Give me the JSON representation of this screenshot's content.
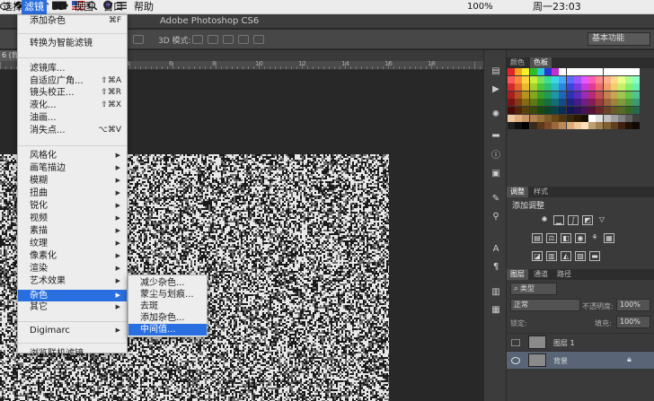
{
  "menubar": {
    "items": [
      "选择",
      "滤镜",
      "3D",
      "视图",
      "窗口",
      "帮助"
    ],
    "active_item": "滤镜",
    "battery": "100%",
    "clock": "周一23:03"
  },
  "app": {
    "title": "Adobe Photoshop CS6",
    "options_label": "3D 模式:",
    "workspace": "基本功能",
    "doc_tab": "6 (背景"
  },
  "ruler": {
    "labels": [
      "4",
      "6",
      "8",
      "10",
      "12",
      "14",
      "16",
      "18"
    ]
  },
  "filter_menu": {
    "items": [
      {
        "label": "添加杂色",
        "shortcut": "⌘F"
      },
      {
        "label": "转换为智能滤镜"
      },
      {
        "label": "滤镜库..."
      },
      {
        "label": "自适应广角...",
        "shortcut": "⇧⌘A"
      },
      {
        "label": "镜头校正...",
        "shortcut": "⇧⌘R"
      },
      {
        "label": "液化...",
        "shortcut": "⇧⌘X"
      },
      {
        "label": "油画..."
      },
      {
        "label": "消失点...",
        "shortcut": "⌥⌘V"
      },
      {
        "label": "风格化",
        "submenu": true
      },
      {
        "label": "画笔描边",
        "submenu": true
      },
      {
        "label": "模糊",
        "submenu": true
      },
      {
        "label": "扭曲",
        "submenu": true
      },
      {
        "label": "锐化",
        "submenu": true
      },
      {
        "label": "视频",
        "submenu": true
      },
      {
        "label": "素描",
        "submenu": true
      },
      {
        "label": "纹理",
        "submenu": true
      },
      {
        "label": "像素化",
        "submenu": true
      },
      {
        "label": "渲染",
        "submenu": true
      },
      {
        "label": "艺术效果",
        "submenu": true
      },
      {
        "label": "杂色",
        "submenu": true,
        "highlighted": true
      },
      {
        "label": "其它",
        "submenu": true
      },
      {
        "label": "Digimarc",
        "submenu": true
      },
      {
        "label": "浏览联机滤镜..."
      }
    ]
  },
  "noise_submenu": {
    "items": [
      {
        "label": "减少杂色..."
      },
      {
        "label": "蒙尘与划痕..."
      },
      {
        "label": "去斑"
      },
      {
        "label": "添加杂色..."
      },
      {
        "label": "中间值...",
        "highlighted": true
      }
    ]
  },
  "panels": {
    "color_tabs": [
      "颜色",
      "色板"
    ],
    "adjust_tabs": [
      "调整",
      "样式"
    ],
    "adjust_title": "添加调整",
    "layer_tabs": [
      "图层",
      "通道",
      "路径"
    ],
    "kind_filter": "类型",
    "blend_mode": "正常",
    "opacity_label": "不透明度:",
    "opacity_value": "100%",
    "lock_label": "锁定:",
    "fill_label": "填充:",
    "fill_value": "100%",
    "layers": [
      {
        "name": "图层 1",
        "selected": false
      },
      {
        "name": "背景",
        "selected": true
      }
    ]
  },
  "colors": {
    "menu_highlight": "#2a6fe0",
    "menu_bg": "#ededed",
    "app_dark": "#3a3a3a"
  }
}
